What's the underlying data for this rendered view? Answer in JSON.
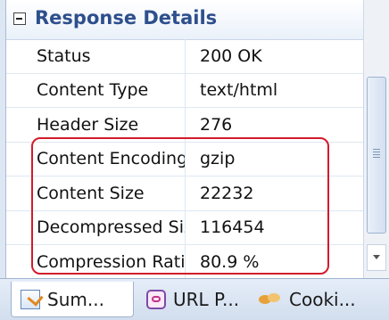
{
  "section": {
    "title": "Response Details"
  },
  "rows": [
    {
      "key": "Status",
      "value": "200 OK"
    },
    {
      "key": "Content Type",
      "value": "text/html"
    },
    {
      "key": "Header Size",
      "value": "276"
    },
    {
      "key": "Content Encoding",
      "value": "gzip"
    },
    {
      "key": "Content Size",
      "value": "22232"
    },
    {
      "key": "Decompressed Size",
      "value": "116454"
    },
    {
      "key": "Compression Ratio",
      "value": "80.9 %"
    }
  ],
  "tabs": [
    {
      "label": "Sum...",
      "icon": "summary-icon",
      "active": true
    },
    {
      "label": "URL P...",
      "icon": "url-parameters-icon",
      "active": false
    },
    {
      "label": "Cooki...",
      "icon": "cookies-icon",
      "active": false
    }
  ],
  "colors": {
    "section_title": "#2d4f8c",
    "highlight": "#d11c2b"
  }
}
